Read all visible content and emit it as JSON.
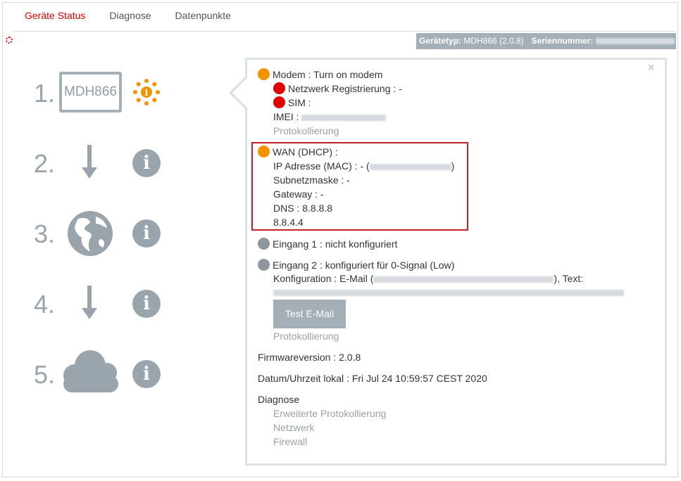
{
  "tabs": [
    {
      "label": "Geräte Status"
    },
    {
      "label": "Diagnose"
    },
    {
      "label": "Datenpunkte"
    }
  ],
  "infobar": {
    "device_type_label": "Gerätetyp:",
    "device_type_value": "MDH866 (2.0.8)",
    "serial_label": "Seriennummer:",
    "trailing": "- -"
  },
  "steps": {
    "s1": "1.",
    "s2": "2.",
    "s3": "3.",
    "s4": "4.",
    "s5": "5.",
    "device_label": "MDH866",
    "info_glyph": "i"
  },
  "panel": {
    "close": "×",
    "modem": "Modem : Turn on modem",
    "netzwerk": "Netzwerk Registrierung : -",
    "sim": "SIM :",
    "imei_label": "IMEI :",
    "protokollierung1": "Protokollierung",
    "wan": "WAN (DHCP) :",
    "ip_prefix": "IP Adresse (MAC) : - (",
    "ip_suffix": ")",
    "subnet": "Subnetzmaske : -",
    "gateway": "Gateway : -",
    "dns1": "DNS : 8.8.8.8",
    "dns2": "8.8.4.4",
    "eingang1": "Eingang 1 : nicht konfiguriert",
    "eingang2": "Eingang 2 : konfiguriert für 0-Signal (Low)",
    "konfig_prefix": "Konfiguration : E-Mail (",
    "konfig_suffix": "), Text:",
    "test_email": "Test E-Mail",
    "protokollierung2": "Protokollierung",
    "firmware": "Firmwareversion : 2.0.8",
    "datetime": "Datum/Uhrzeit lokal : Fri Jul 24 10:59:57 CEST 2020",
    "diagnose": "Diagnose",
    "erweiterte": "Erweiterte Protokollierung",
    "netzwerk_link": "Netzwerk",
    "firewall": "Firewall"
  },
  "colors": {
    "accent": "#d40000",
    "status_orange": "#f39200",
    "status_red": "#e00000",
    "status_grey": "#8f979e",
    "icon_grey": "#9aa4ad"
  },
  "icons": [
    "spinner-icon",
    "gear-status-icon",
    "arrow-down-icon",
    "globe-icon",
    "cloud-icon",
    "info-icon",
    "close-icon"
  ]
}
